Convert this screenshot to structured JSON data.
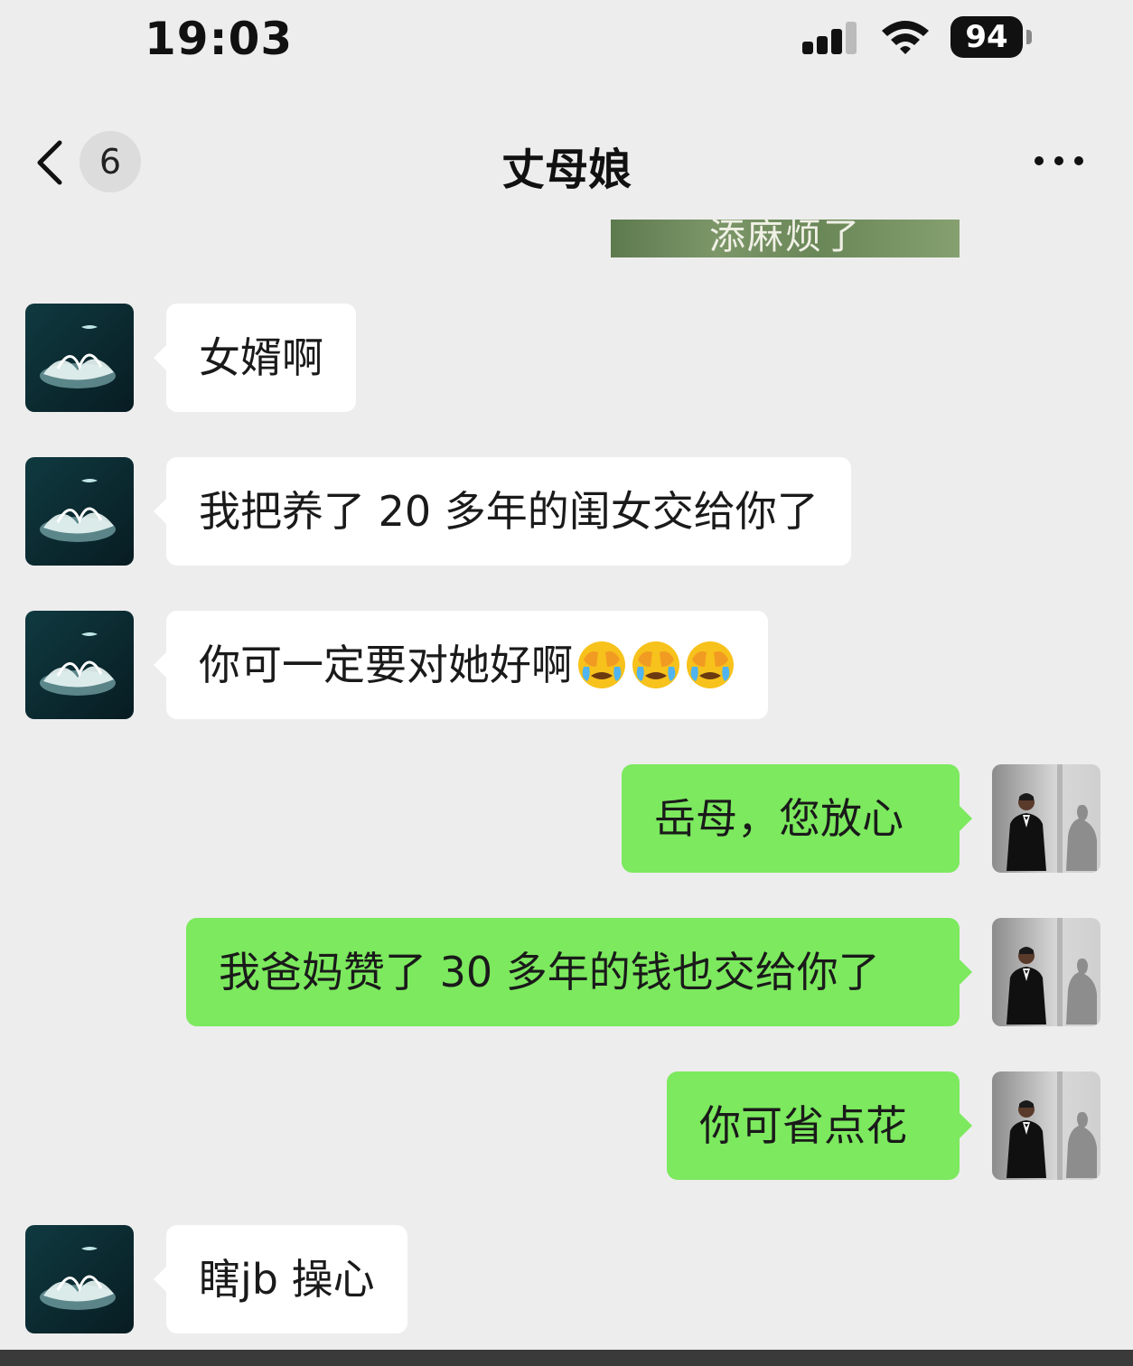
{
  "status_bar": {
    "time": "19:03",
    "battery": "94"
  },
  "nav": {
    "unread_count": "6",
    "title": "丈母娘"
  },
  "partial_image_caption": "添麻烦了",
  "messages": [
    {
      "side": "left",
      "text": "女婿啊"
    },
    {
      "side": "left",
      "text": "我把养了 20 多年的闺女交给你了"
    },
    {
      "side": "left",
      "text": "你可一定要对她好啊",
      "emoji": [
        "crying-face-icon",
        "crying-face-icon",
        "crying-face-icon"
      ]
    },
    {
      "side": "right",
      "text": "岳母，您放心"
    },
    {
      "side": "right",
      "text": "我爸妈赞了 30 多年的钱也交给你了"
    },
    {
      "side": "right",
      "text": "你可省点花"
    },
    {
      "side": "left",
      "text": "瞎jb 操心"
    }
  ],
  "colors": {
    "background": "#ededed",
    "incoming_bubble": "#ffffff",
    "outgoing_bubble": "#7ce95e"
  }
}
